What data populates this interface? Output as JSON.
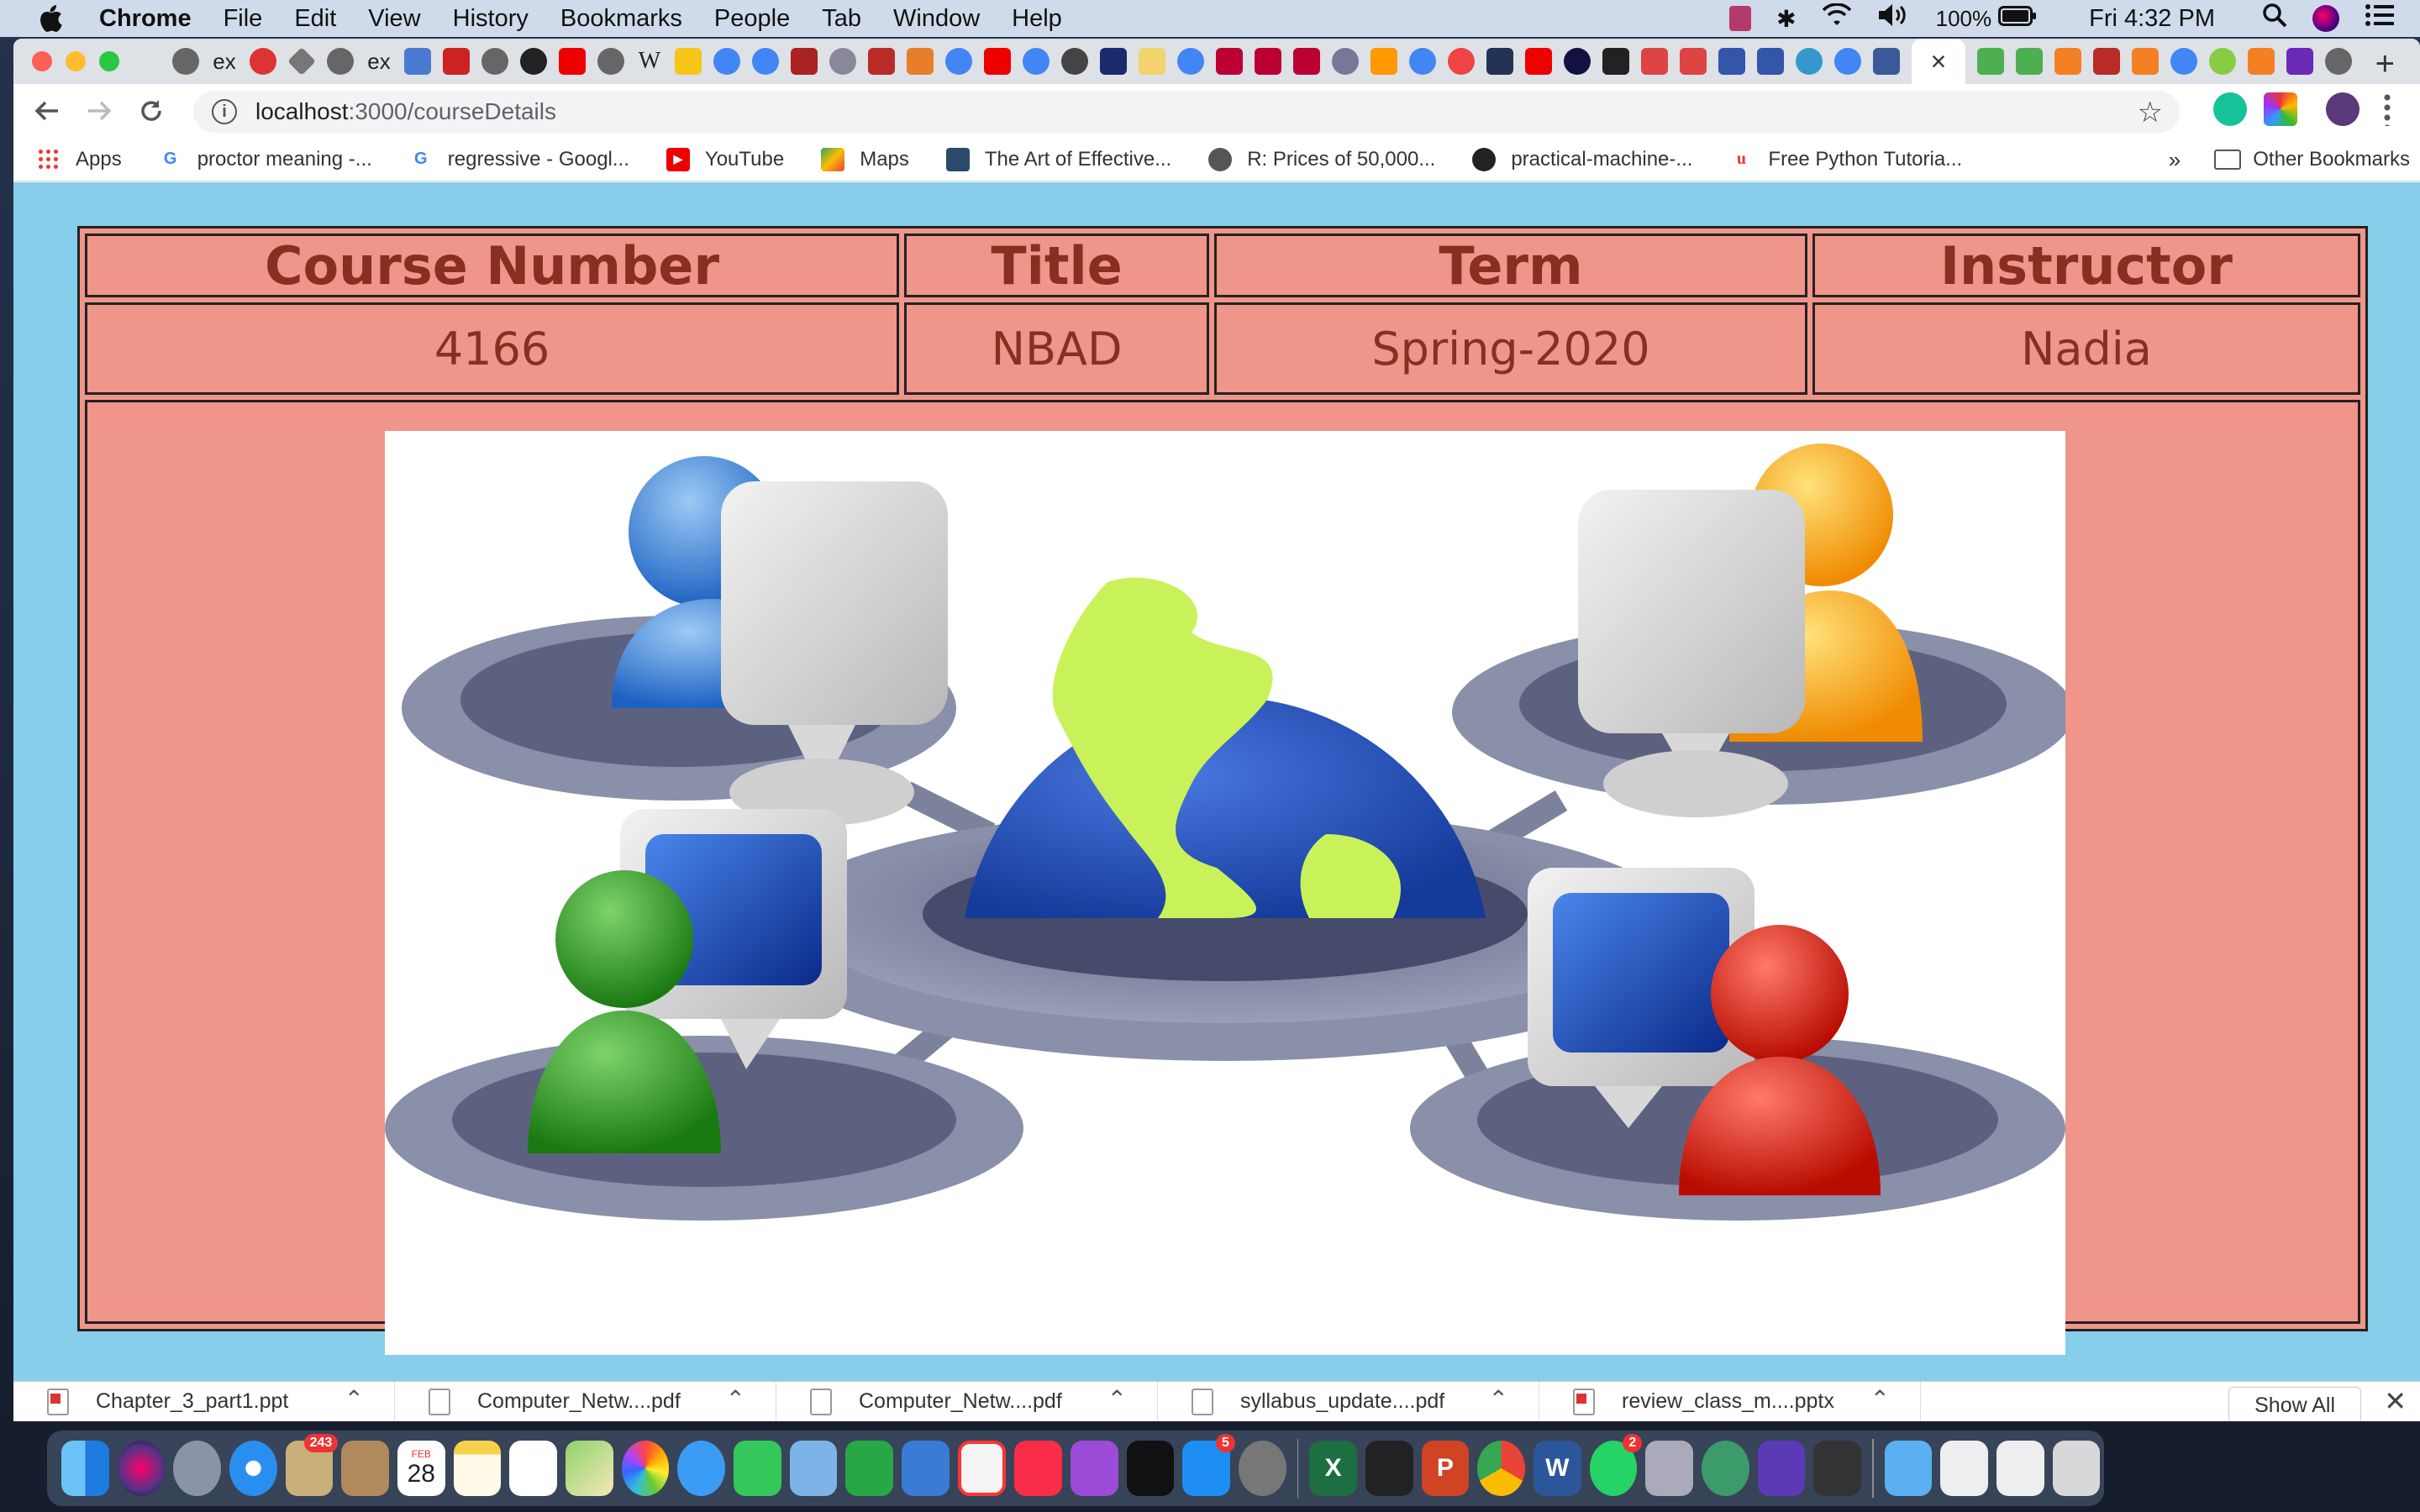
{
  "menubar": {
    "app_name": "Chrome",
    "menus": [
      "File",
      "Edit",
      "View",
      "History",
      "Bookmarks",
      "People",
      "Tab",
      "Window",
      "Help"
    ],
    "battery": "100%",
    "clock": "Fri 4:32 PM"
  },
  "tabstrip": {
    "tab_labels": [
      "ex",
      "ex",
      "W"
    ],
    "close_glyph": "×",
    "new_tab_glyph": "+"
  },
  "toolbar": {
    "url_host": "localhost",
    "url_rest": ":3000/courseDetails"
  },
  "bookmarks": {
    "items": [
      "Apps",
      "proctor meaning -...",
      "regressive - Googl...",
      "YouTube",
      "Maps",
      "The Art of Effective...",
      "R: Prices of 50,000...",
      "practical-machine-...",
      "Free Python Tutoria..."
    ],
    "overflow": "»",
    "other": "Other Bookmarks"
  },
  "course": {
    "headers": [
      "Course Number",
      "Title",
      "Term",
      "Instructor"
    ],
    "values": [
      "4166",
      "NBAD",
      "Spring-2020",
      "Nadia"
    ]
  },
  "downloads": {
    "files": [
      "Chapter_3_part1.ppt",
      "Computer_Netw....pdf",
      "Computer_Netw....pdf",
      "syllabus_update....pdf",
      "review_class_m....pptx"
    ],
    "show_all": "Show All"
  },
  "dock": {
    "calendar_month": "FEB",
    "calendar_day": "28",
    "badges": [
      "243",
      "5",
      "2"
    ],
    "app_letters": [
      "X",
      "P",
      "W"
    ]
  }
}
